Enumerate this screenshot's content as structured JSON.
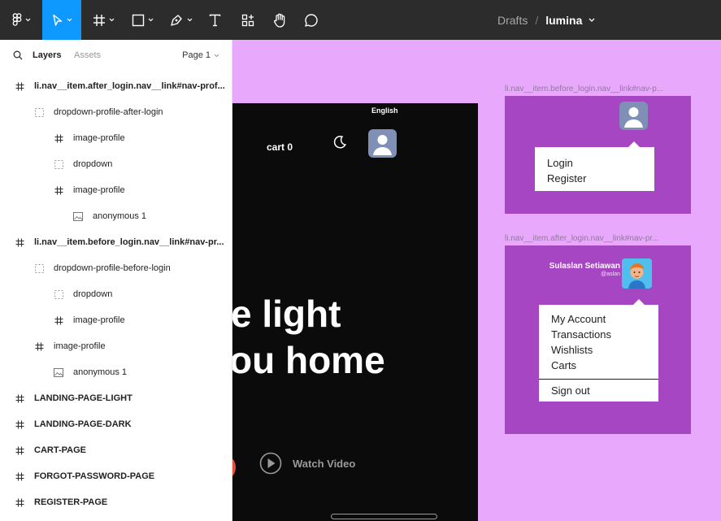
{
  "toolbar": {
    "breadcrumb": {
      "project": "Drafts",
      "separator": "/",
      "file": "lumina"
    },
    "tools": [
      "figma-menu-icon",
      "move-icon",
      "frame-icon",
      "shape-icon",
      "pen-icon",
      "text-icon",
      "components-icon",
      "hand-icon",
      "comment-icon"
    ],
    "active_tool": "move-icon"
  },
  "panel": {
    "tabs": {
      "layers": "Layers",
      "assets": "Assets"
    },
    "page_select": "Page 1",
    "layers": [
      {
        "label": "li.nav__item.after_login.nav__link#nav-prof...",
        "icon": "frame-icon"
      },
      {
        "label": "dropdown-profile-after-login",
        "icon": "group-dashed-icon"
      },
      {
        "label": "image-profile",
        "icon": "frame-icon"
      },
      {
        "label": "dropdown",
        "icon": "group-dashed-icon"
      },
      {
        "label": "image-profile",
        "icon": "frame-icon"
      },
      {
        "label": "anonymous 1",
        "icon": "image-icon"
      },
      {
        "label": "li.nav__item.before_login.nav__link#nav-pr...",
        "icon": "frame-icon"
      },
      {
        "label": "dropdown-profile-before-login",
        "icon": "group-dashed-icon"
      },
      {
        "label": "dropdown",
        "icon": "group-dashed-icon"
      },
      {
        "label": "image-profile",
        "icon": "frame-icon"
      },
      {
        "label": "image-profile",
        "icon": "frame-icon"
      },
      {
        "label": "anonymous 1",
        "icon": "image-icon"
      },
      {
        "label": "LANDING-PAGE-LIGHT",
        "icon": "frame-icon"
      },
      {
        "label": "LANDING-PAGE-DARK",
        "icon": "frame-icon"
      },
      {
        "label": "CART-PAGE",
        "icon": "frame-icon"
      },
      {
        "label": "FORGOT-PASSWORD-PAGE",
        "icon": "frame-icon"
      },
      {
        "label": "REGISTER-PAGE",
        "icon": "frame-icon"
      }
    ]
  },
  "canvas": {
    "dark_frame": {
      "language": "English",
      "cart": "cart 0",
      "hero_line1": "e light",
      "hero_line2": "ou home",
      "watch_video": "Watch Video"
    },
    "before_login": {
      "frame_label": "li.nav__item.before_login.nav__link#nav-p...",
      "menu": [
        "Login",
        "Register"
      ]
    },
    "after_login": {
      "frame_label": "li.nav__item.after_login.nav__link#nav-pr...",
      "user_name": "Sulaslan Setiawan",
      "user_handle": "@aslan",
      "menu": [
        "My Account",
        "Transactions",
        "Wishlists",
        "Carts"
      ],
      "signout": "Sign out"
    }
  },
  "colors": {
    "toolbar_bg": "#2c2c2c",
    "active_tool": "#0d99ff",
    "canvas_bg": "#e8a8fb",
    "frame_purple": "#a646c3",
    "dark_frame": "#0b0b0b"
  }
}
